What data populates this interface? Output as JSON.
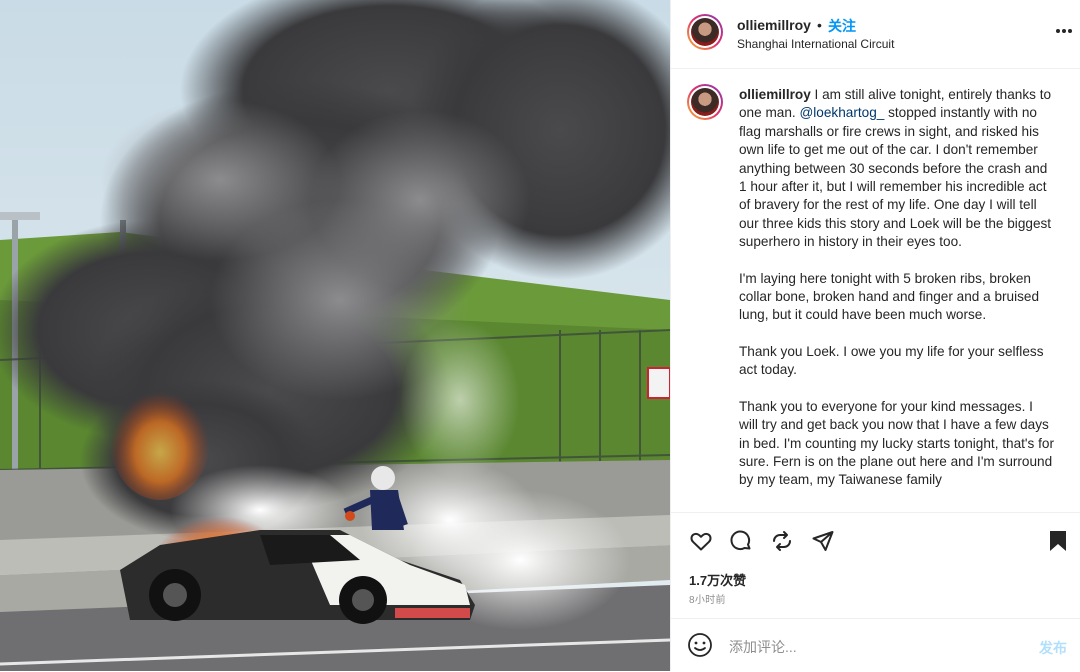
{
  "post": {
    "username": "olliemillroy",
    "separator": "•",
    "follow_label": "关注",
    "location": "Shanghai International Circuit",
    "more_icon": "more-horizontal-icon"
  },
  "caption": {
    "username": "olliemillroy",
    "intro": "I am still alive tonight, entirely thanks to one man.",
    "mention": "@loekhartog_",
    "p1_rest": "stopped instantly with no flag marshalls or fire crews in sight, and risked his own life to get me out of the car. I don't remember anything between 30 seconds before the crash and 1 hour after it, but I will remember his incredible act of bravery for the rest of my life. One day I will tell our three kids this story and Loek will be the biggest superhero in history in their eyes too.",
    "p2": "I'm laying here tonight with 5 broken ribs, broken collar bone, broken hand and finger and a bruised lung, but it could have been much worse.",
    "p3": "Thank you Loek. I owe you my life for your selfless act today.",
    "p4": "Thank you to everyone for your kind messages. I will try and get back you now that I have a few days in bed. I'm counting my lucky starts tonight, that's for sure. Fern is on the plane out here and I'm surround by my team, my Taiwanese family"
  },
  "actions": {
    "likes": "1.7万次赞",
    "time": "8小时前",
    "icons": [
      "heart-icon",
      "comment-icon",
      "share-icon",
      "send-icon",
      "bookmark-icon"
    ]
  },
  "comment_box": {
    "placeholder": "添加评论...",
    "post_label": "发布",
    "emoji_icon": "emoji-icon"
  },
  "colors": {
    "link_blue": "#0095f6",
    "mention_blue": "#00376b",
    "post_disabled": "#b2dffc",
    "secondary_text": "#8e8e8e"
  }
}
